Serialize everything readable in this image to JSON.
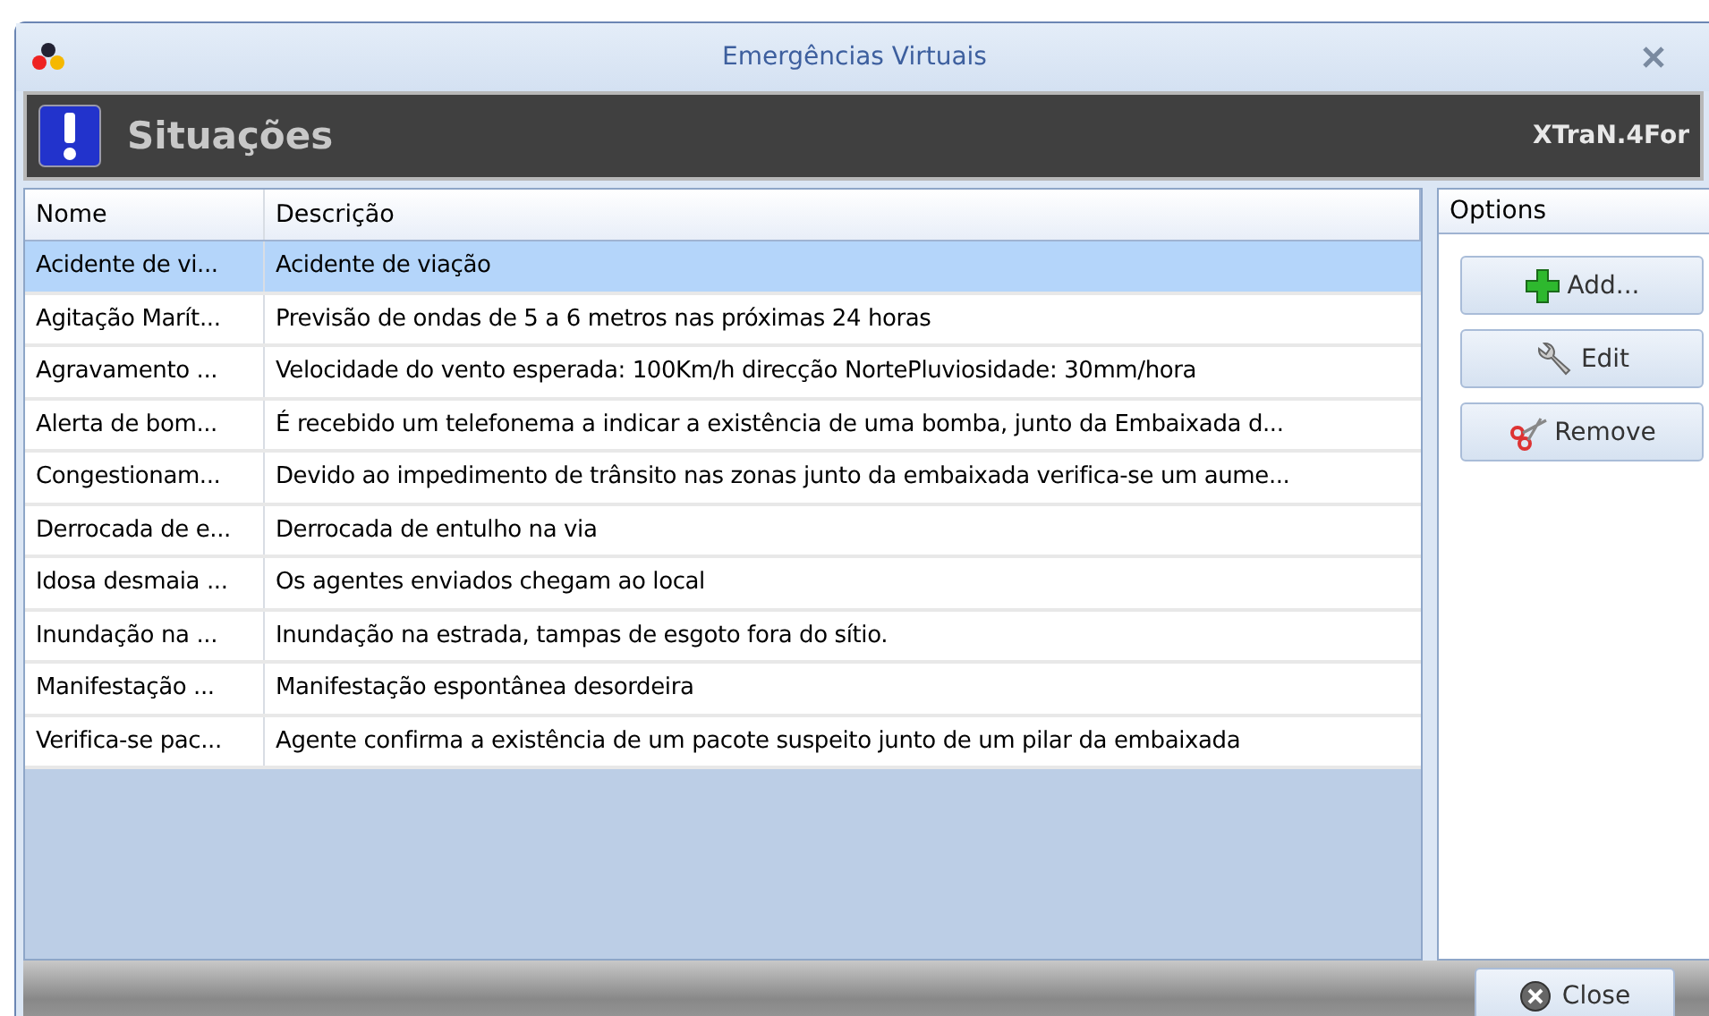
{
  "window": {
    "title": "Emergências Virtuais"
  },
  "header": {
    "title": "Situações",
    "brand": "XTraN.4For"
  },
  "table": {
    "columns": [
      "Nome",
      "Descrição"
    ],
    "rows": [
      {
        "cells": [
          "Acidente de vi...",
          "Acidente de viação"
        ],
        "selected": true
      },
      {
        "cells": [
          "Agitação Marít...",
          "Previsão de ondas de 5 a 6 metros nas próximas 24 horas"
        ],
        "selected": false
      },
      {
        "cells": [
          "Agravamento ...",
          "Velocidade do vento esperada: 100Km/h direcção NortePluviosidade: 30mm/hora"
        ],
        "selected": false
      },
      {
        "cells": [
          "Alerta de bom...",
          "É recebido um telefonema a indicar a existência de uma bomba, junto da Embaixada d..."
        ],
        "selected": false
      },
      {
        "cells": [
          "Congestionam...",
          "Devido ao impedimento de trânsito nas zonas junto da embaixada verifica-se um aume..."
        ],
        "selected": false
      },
      {
        "cells": [
          "Derrocada de e...",
          "Derrocada de entulho na via"
        ],
        "selected": false
      },
      {
        "cells": [
          "Idosa desmaia ...",
          "Os agentes enviados chegam ao local"
        ],
        "selected": false
      },
      {
        "cells": [
          "Inundação na ...",
          "Inundação na estrada, tampas de esgoto fora do sítio."
        ],
        "selected": false
      },
      {
        "cells": [
          "Manifestação ...",
          "Manifestação espontânea desordeira"
        ],
        "selected": false
      },
      {
        "cells": [
          "Verifica-se pac...",
          "Agente confirma a existência de um pacote suspeito junto de um pilar da embaixada"
        ],
        "selected": false
      }
    ]
  },
  "options": {
    "title": "Options",
    "buttons": [
      {
        "label": "Add...",
        "kind": "add"
      },
      {
        "label": "Edit",
        "kind": "edit"
      },
      {
        "label": "Remove",
        "kind": "remove"
      }
    ]
  },
  "footer": {
    "close_button": "Close"
  }
}
